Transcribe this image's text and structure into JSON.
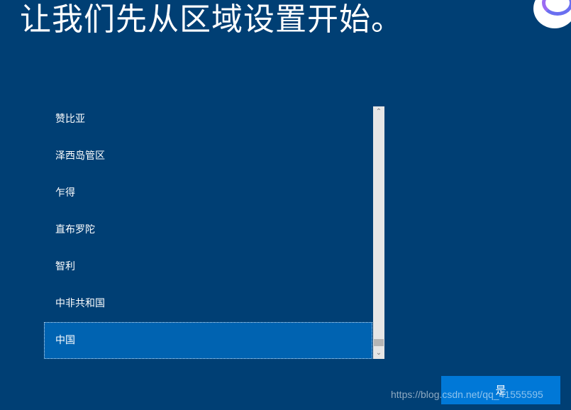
{
  "header": {
    "title": "让我们先从区域设置开始。"
  },
  "region_list": {
    "items": [
      {
        "label": "赞比亚"
      },
      {
        "label": "泽西岛管区"
      },
      {
        "label": "乍得"
      },
      {
        "label": "直布罗陀"
      },
      {
        "label": "智利"
      },
      {
        "label": "中非共和国"
      },
      {
        "label": "中国",
        "selected": true
      }
    ],
    "selected_value": "中国"
  },
  "scrollbar": {
    "up_icon": "chevron-up-icon",
    "down_icon": "chevron-down-icon"
  },
  "actions": {
    "next_label": "是"
  },
  "watermark": {
    "text": "https://blog.csdn.net/qq_41555595"
  },
  "colors": {
    "background": "#003f74",
    "selected_item": "#0063b1",
    "button": "#0078d7"
  }
}
